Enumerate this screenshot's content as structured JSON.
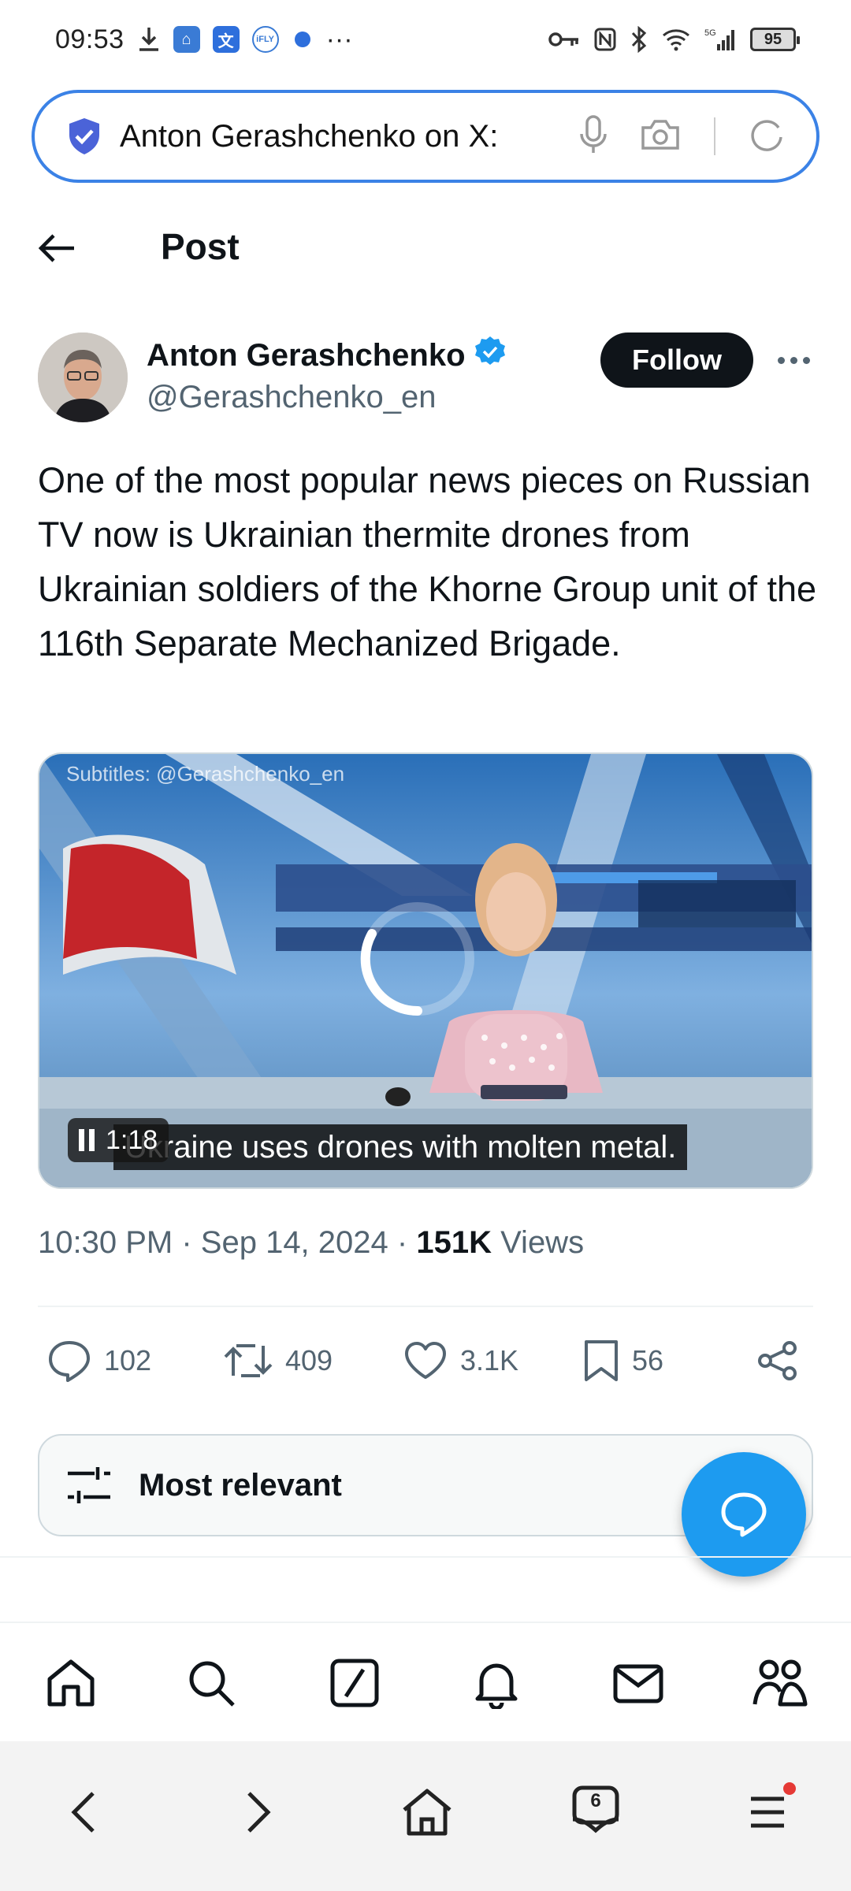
{
  "status_bar": {
    "time": "09:53",
    "more": "···",
    "network": "5G",
    "battery": "95"
  },
  "url_bar": {
    "text": "Anton Gerashchenko on X:"
  },
  "header": {
    "title": "Post"
  },
  "author": {
    "name": "Anton Gerashchenko",
    "handle": "@Gerashchenko_en",
    "follow_label": "Follow"
  },
  "post": {
    "text": "One of the most popular news pieces on Russian TV now is Ukrainian thermite drones from Ukrainian soldiers of the Khorne Group unit of the 116th Separate Mechanized Brigade.",
    "video": {
      "subtitle_credit": "Subtitles: @Gerashchenko_en",
      "caption": "Ukraine uses drones with molten metal.",
      "time": "1:18"
    },
    "time": "10:30 PM",
    "date": "Sep 14, 2024",
    "views_count": "151K",
    "views_label": "Views"
  },
  "actions": {
    "replies": "102",
    "reposts": "409",
    "likes": "3.1K",
    "bookmarks": "56"
  },
  "sort": {
    "label": "Most relevant"
  },
  "browser": {
    "tab_count": "6"
  },
  "colors": {
    "accent": "#1d9bf0",
    "url_border": "#3b82e6",
    "text_primary": "#0f1419",
    "text_secondary": "#536471"
  }
}
